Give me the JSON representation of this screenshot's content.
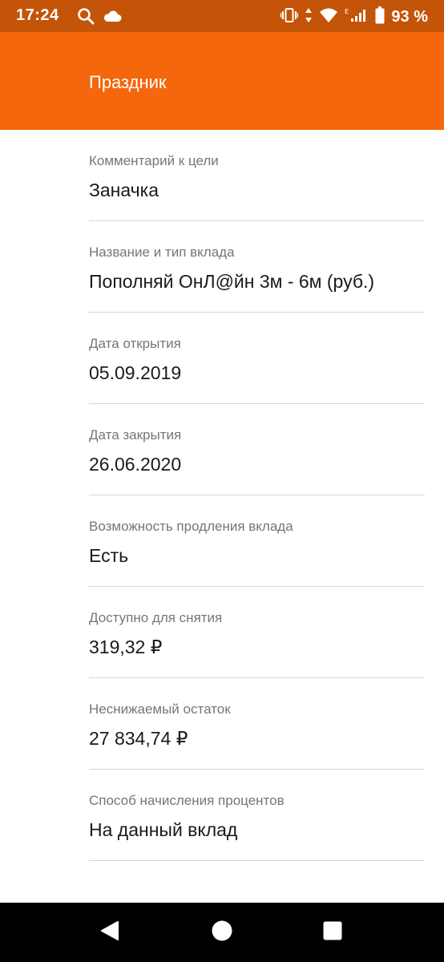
{
  "status_bar": {
    "time": "17:24",
    "battery_percent": "93 %",
    "icons": [
      "search-icon",
      "cloud-icon",
      "vibrate-icon",
      "data-transfer-icon",
      "wifi-icon",
      "signal-icon",
      "battery-icon"
    ],
    "background_color": "#c45408"
  },
  "app_bar": {
    "title": "Праздник",
    "background_color": "#f4670d"
  },
  "fields": [
    {
      "label": "Комментарий к цели",
      "value": "Заначка"
    },
    {
      "label": "Название и тип вклада",
      "value": "Пополняй ОнЛ@йн 3м - 6м (руб.)"
    },
    {
      "label": "Дата открытия",
      "value": "05.09.2019"
    },
    {
      "label": "Дата закрытия",
      "value": "26.06.2020"
    },
    {
      "label": "Возможность продления вклада",
      "value": "Есть"
    },
    {
      "label": "Доступно для снятия",
      "value": "319,32 ₽"
    },
    {
      "label": "Неснижаемый остаток",
      "value": "27 834,74 ₽"
    },
    {
      "label": "Способ начисления процентов",
      "value": "На данный вклад"
    }
  ],
  "nav_bar": {
    "icons": [
      "back-icon",
      "home-icon",
      "recents-icon"
    ]
  }
}
